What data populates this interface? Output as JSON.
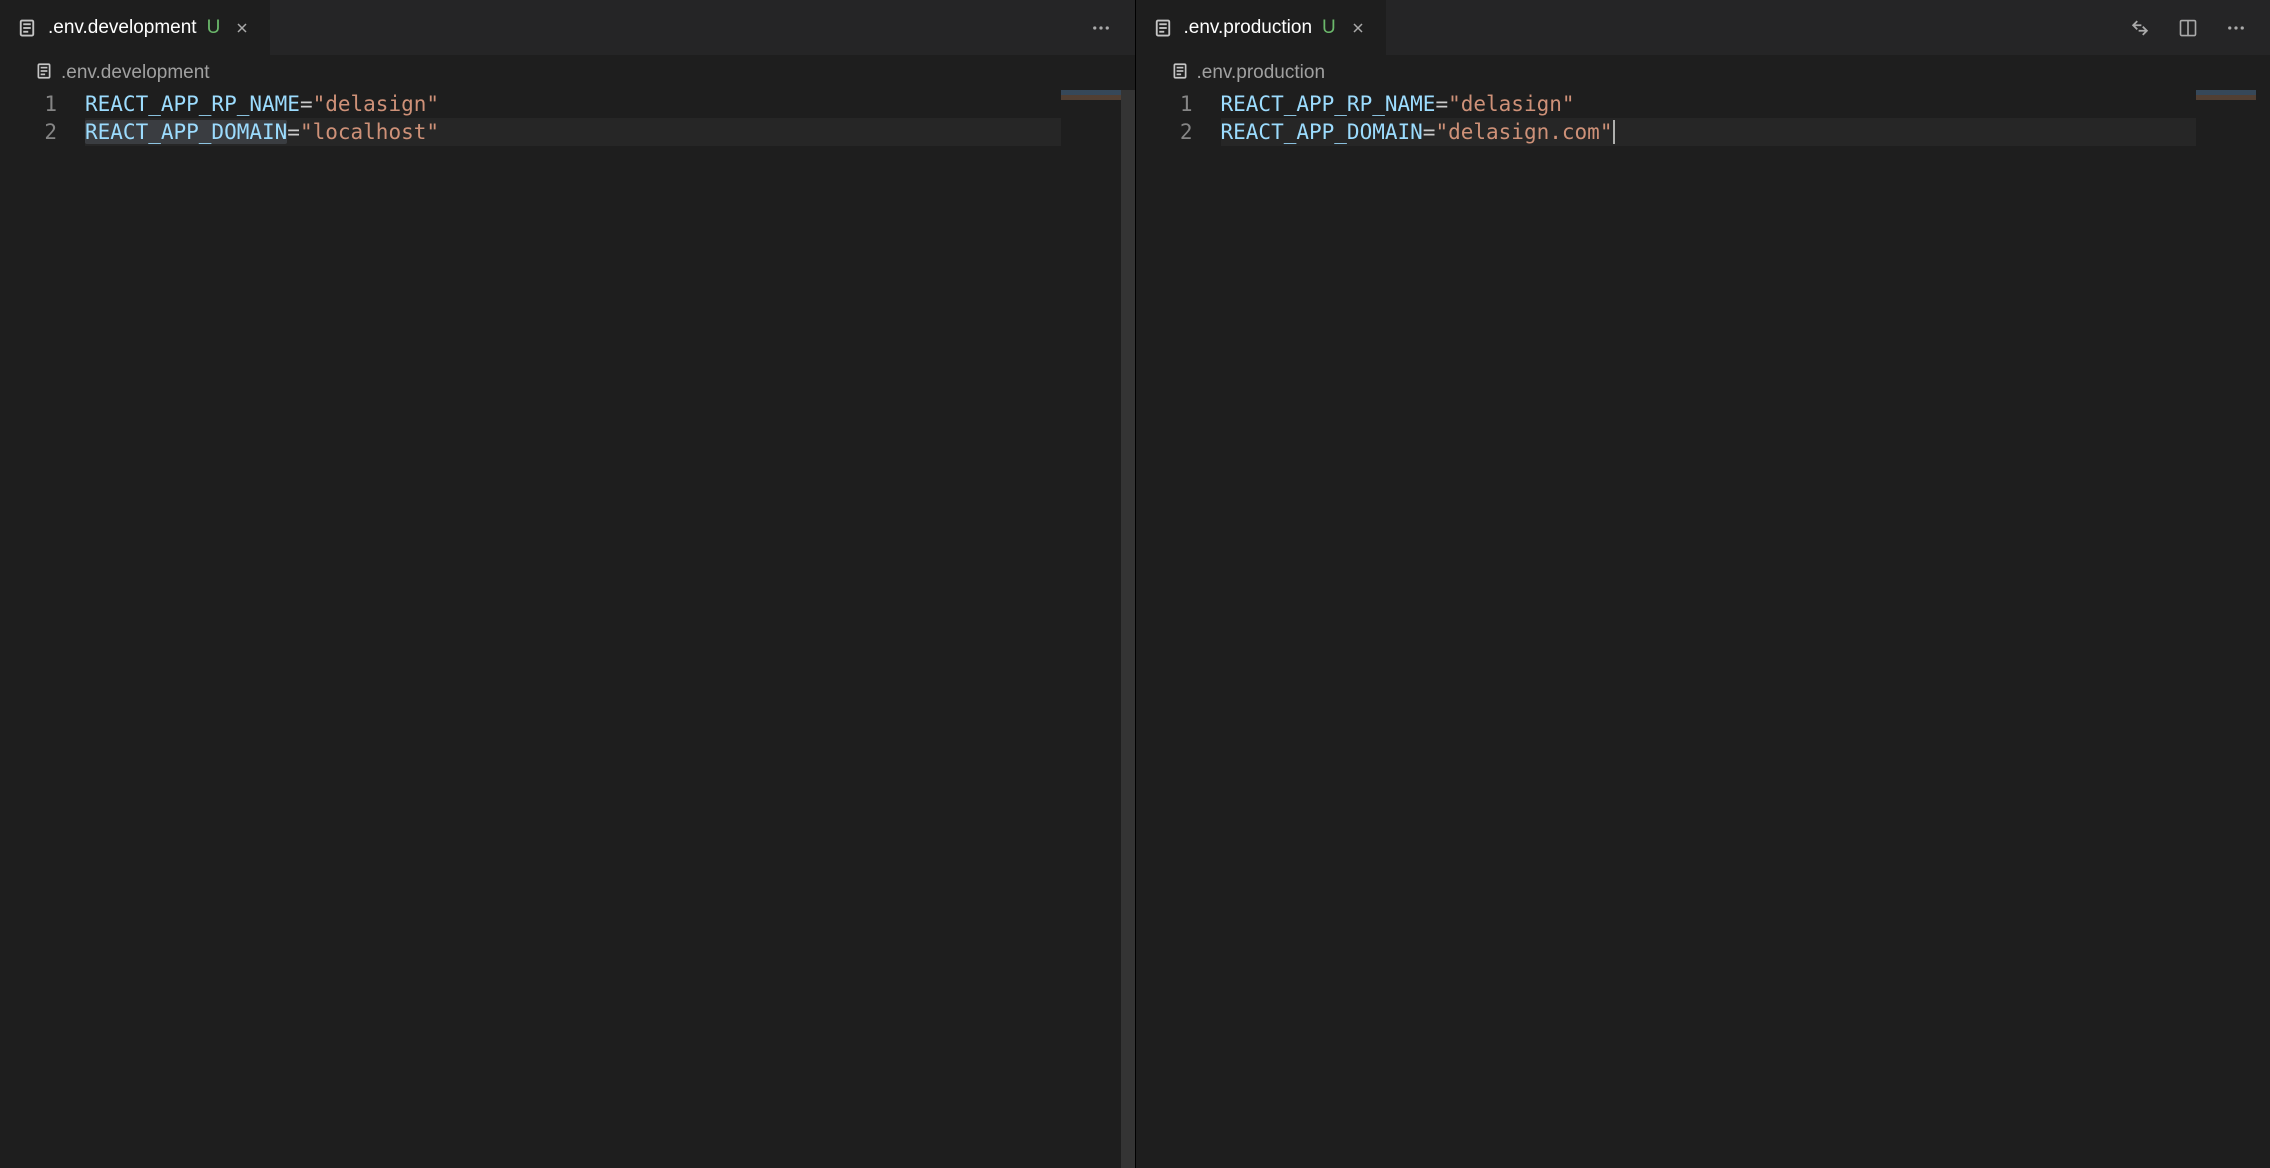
{
  "panes": {
    "left": {
      "tab": {
        "filename": ".env.development",
        "status": "U"
      },
      "breadcrumb": ".env.development",
      "lines": [
        {
          "num": "1",
          "var": "REACT_APP_RP_NAME",
          "value": "\"delasign\"",
          "highlighted": false,
          "selected": false
        },
        {
          "num": "2",
          "var": "REACT_APP_DOMAIN",
          "value": "\"localhost\"",
          "highlighted": true,
          "selected": true
        }
      ]
    },
    "right": {
      "tab": {
        "filename": ".env.production",
        "status": "U"
      },
      "breadcrumb": ".env.production",
      "lines": [
        {
          "num": "1",
          "var": "REACT_APP_RP_NAME",
          "value": "\"delasign\"",
          "highlighted": false,
          "selected": false
        },
        {
          "num": "2",
          "var": "REACT_APP_DOMAIN",
          "value": "\"delasign.com\"",
          "highlighted": true,
          "selected": false,
          "cursor": true
        }
      ]
    }
  }
}
